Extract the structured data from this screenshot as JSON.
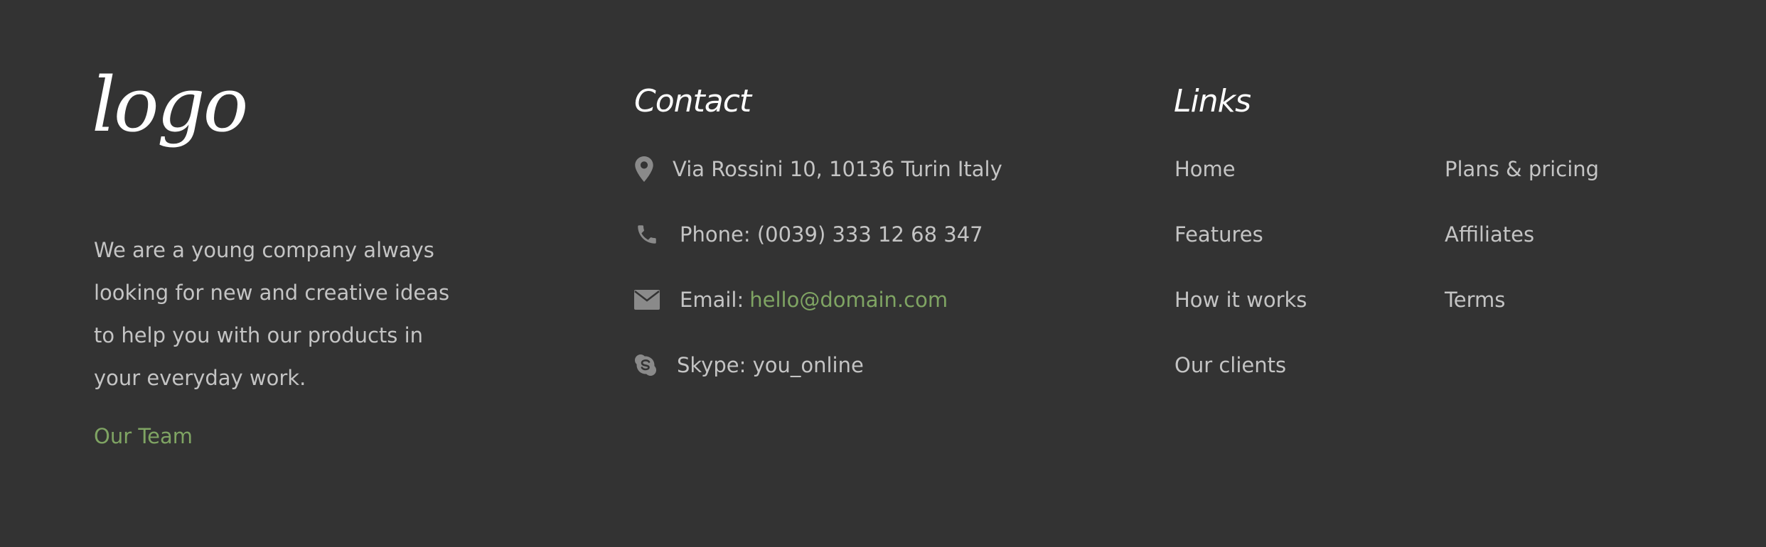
{
  "logo": {
    "text": "logo"
  },
  "about": {
    "text": "We are a young company always looking for new and creative ideas to help you with our products in your everyday work.",
    "team_link": "Our Team"
  },
  "contact": {
    "title": "Contact",
    "address": "Via Rossini 10, 10136 Turin Italy",
    "phone": "Phone: (0039) 333 12 68 347",
    "email_label": "Email:",
    "email": "hello@domain.com",
    "skype": "Skype: you_online"
  },
  "links": {
    "title": "Links",
    "column1": [
      "Home",
      "Features",
      "How it works",
      "Our clients"
    ],
    "column2": [
      "Plans & pricing",
      "Affiliates",
      "Terms"
    ]
  },
  "colors": {
    "background": "#333333",
    "text": "#c4c4c4",
    "heading": "#ffffff",
    "accent": "#7fa463",
    "icon": "#8a8a8a"
  },
  "icons": {
    "address": "map-marker-icon",
    "phone": "phone-icon",
    "email": "envelope-icon",
    "skype": "skype-icon"
  }
}
